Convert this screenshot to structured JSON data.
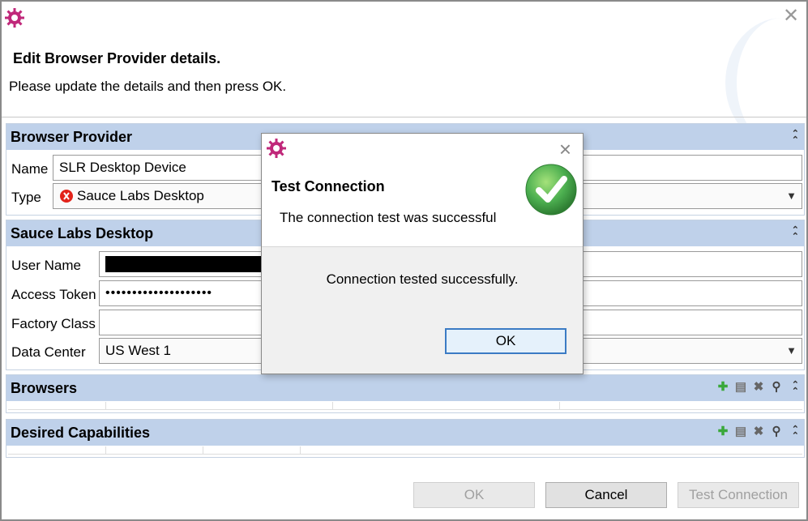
{
  "dialog": {
    "title": "Edit Browser Provider details.",
    "subtitle": "Please update the details and then press OK."
  },
  "browser_provider": {
    "heading": "Browser Provider",
    "name_label": "Name",
    "name_value": "SLR Desktop Device",
    "type_label": "Type",
    "type_value": "Sauce Labs Desktop"
  },
  "sauce": {
    "heading": "Sauce Labs Desktop",
    "user_label": "User Name",
    "token_label": "Access Token",
    "token_value": "••••••••••••••••••••",
    "factory_label": "Factory Class",
    "datacenter_label": "Data Center",
    "datacenter_value": "US West 1"
  },
  "browsers": {
    "heading": "Browsers"
  },
  "capabilities": {
    "heading": "Desired Capabilities"
  },
  "buttons": {
    "ok": "OK",
    "cancel": "Cancel",
    "test": "Test Connection"
  },
  "modal": {
    "title": "Test Connection",
    "message": "The connection test was successful",
    "body": "Connection tested successfully.",
    "ok": "OK"
  },
  "icons": {
    "close": "close-icon",
    "gear": "gear-icon",
    "check": "check-icon",
    "add": "add-icon",
    "copy": "copy-icon",
    "delete": "delete-icon",
    "search": "search-icon",
    "collapse": "collapse-icon"
  },
  "colors": {
    "section_header": "#bfd1ea",
    "accent_blue": "#3b7bc4",
    "gear": "#c0287a",
    "success": "#4caf50"
  }
}
